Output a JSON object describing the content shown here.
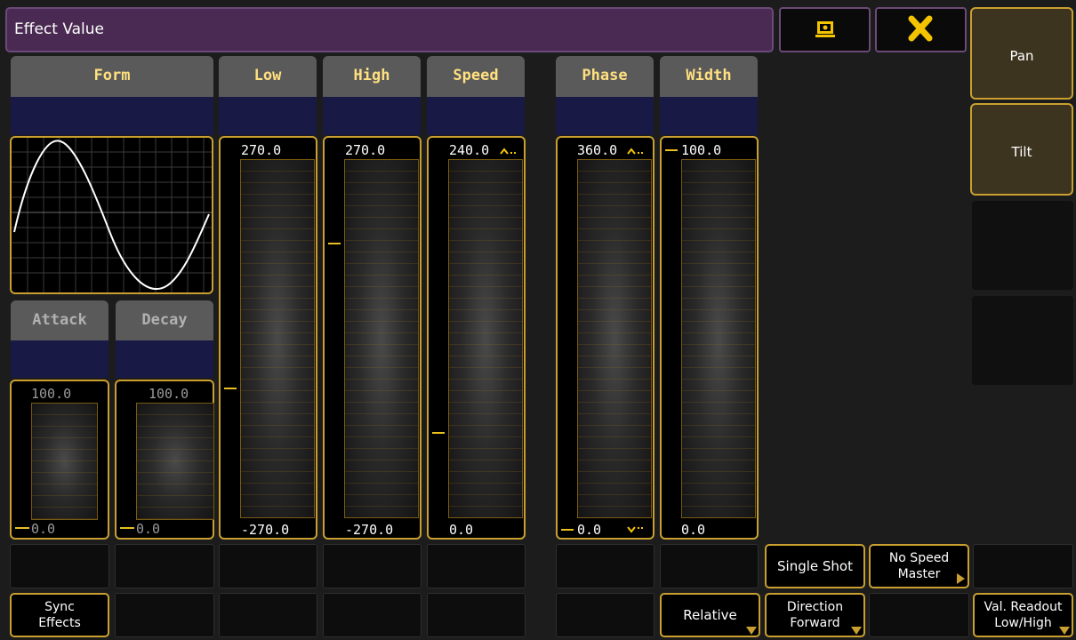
{
  "window": {
    "title": "Effect Value"
  },
  "topbar": {
    "screenshot_icon": "camera-screen-icon",
    "close_icon": "close-x-icon",
    "close_color": "#f5c400"
  },
  "side": {
    "pan": "Pan",
    "tilt": "Tilt"
  },
  "headers": {
    "form": "Form",
    "low": "Low",
    "high": "High",
    "speed": "Speed",
    "phase": "Phase",
    "width": "Width",
    "attack": "Attack",
    "decay": "Decay"
  },
  "faders": {
    "attack": {
      "top": "100.0",
      "bottom": "0.0",
      "level": 0.0
    },
    "decay": {
      "top": "100.0",
      "bottom": "0.0",
      "level": 0.0
    },
    "low": {
      "top": "270.0",
      "bottom": "-270.0",
      "level": 0.4
    },
    "high": {
      "top": "270.0",
      "bottom": "-270.0",
      "level": 0.77
    },
    "speed": {
      "top": "240.0",
      "bottom": "0.0",
      "level": 0.26
    },
    "phase": {
      "top": "360.0",
      "bottom": "0.0",
      "level": 0.0
    },
    "width": {
      "top": "100.0",
      "bottom": "0.0",
      "level": 1.0
    }
  },
  "buttons": {
    "sync_effects": "Sync\nEffects",
    "relative": "Relative",
    "direction": "Direction\nForward",
    "single_shot": "Single Shot",
    "no_speed_master": "No Speed\nMaster",
    "val_readout": "Val. Readout\nLow/High"
  },
  "colors": {
    "accent": "#c9a030",
    "title_bg": "#4a2a52",
    "header_text": "#ffe080",
    "marker": "#e8c020"
  }
}
